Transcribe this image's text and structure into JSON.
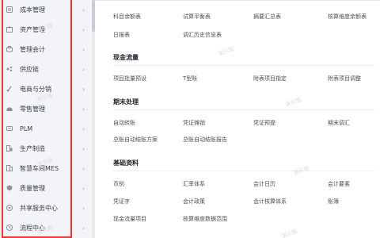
{
  "sidebar": {
    "items": [
      {
        "label": "成本管理",
        "icon": "cost-icon"
      },
      {
        "label": "资产管理",
        "icon": "asset-icon"
      },
      {
        "label": "管理会计",
        "icon": "accounting-icon"
      },
      {
        "label": "供应链",
        "icon": "supply-chain-icon"
      },
      {
        "label": "电商与分销",
        "icon": "ecommerce-icon"
      },
      {
        "label": "零售管理",
        "icon": "retail-icon"
      },
      {
        "label": "PLM",
        "icon": "plm-icon"
      },
      {
        "label": "生产制造",
        "icon": "manufacturing-icon"
      },
      {
        "label": "智慧车间MES",
        "icon": "mes-icon"
      },
      {
        "label": "质量管理",
        "icon": "quality-icon"
      },
      {
        "label": "共享服务中心",
        "icon": "shared-service-icon"
      },
      {
        "label": "流程中心",
        "icon": "process-icon"
      }
    ],
    "chevron": "›"
  },
  "main": {
    "top_links": {
      "row1": [
        "科目余额表",
        "试算平衡表",
        "摘要汇总表",
        "核算维度余额表"
      ],
      "row2": [
        "日报表",
        "调汇历史信息表"
      ]
    },
    "cash_flow": {
      "title": "现金流量",
      "row1": [
        "项目批量预设",
        "T型账",
        "附表项目指定",
        "附表项目调整"
      ]
    },
    "period_end": {
      "title": "期末处理",
      "row1": [
        "自动转账",
        "凭证摊销",
        "凭证预提",
        "期末调汇"
      ],
      "row2": [
        "总账自动结账方案",
        "总账自动结账报告"
      ]
    },
    "basic_data": {
      "title": "基础资料",
      "row1": [
        "币别",
        "汇率体系",
        "会计日历",
        "会计要素"
      ],
      "row2": [
        "凭证字",
        "会计政策",
        "会计核算体系",
        "账簿"
      ],
      "row3": [
        "现金流量项目",
        "核算维度数据范围"
      ]
    },
    "watermark": "演示版"
  }
}
